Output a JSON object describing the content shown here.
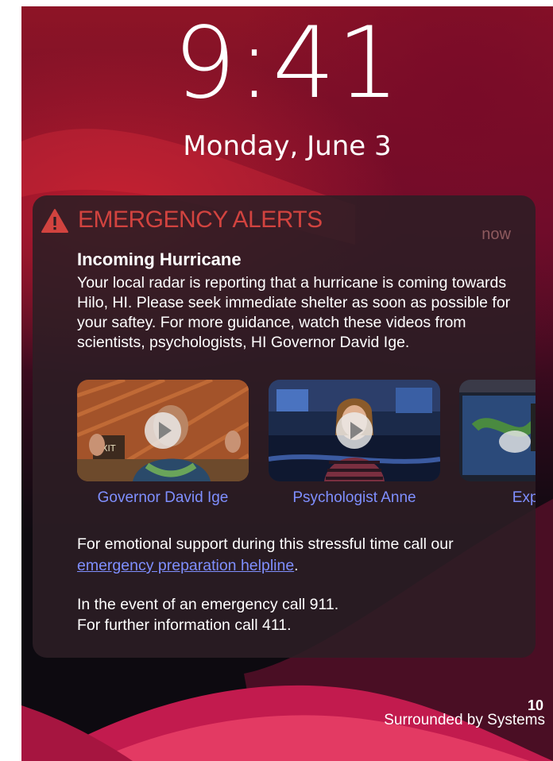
{
  "lockscreen": {
    "time": "9:41",
    "date": "Monday, June 3"
  },
  "notification": {
    "app_name": "EMERGENCY ALERTS",
    "time": "now",
    "title": "Incoming Hurricane",
    "body": "Your local radar is reporting that a hurricane is coming towards Hilo, HI. Please seek immediate shelter as soon as possible for your saftey. For more guidance, watch these videos from scientists, psychologists, HI Governor David Ige.",
    "icon": "warning-triangle-icon",
    "videos": [
      {
        "label": "Governor David Ige",
        "icon": "play-icon"
      },
      {
        "label": "Psychologist Anne",
        "icon": "play-icon"
      },
      {
        "label": "Expert An",
        "icon": "play-icon"
      }
    ],
    "support_text": "For emotional support during this stressful time call our",
    "helpline_link": "emergency preparation helpline",
    "support_end": ".",
    "emergency_line": "In the event of an emergency call 911.",
    "info_line": "For further information call 411."
  },
  "footer": {
    "page_number": "10",
    "text": "Surrounded by Systems"
  },
  "colors": {
    "alert_red": "#d2433f",
    "link_blue": "#7f8fff"
  }
}
